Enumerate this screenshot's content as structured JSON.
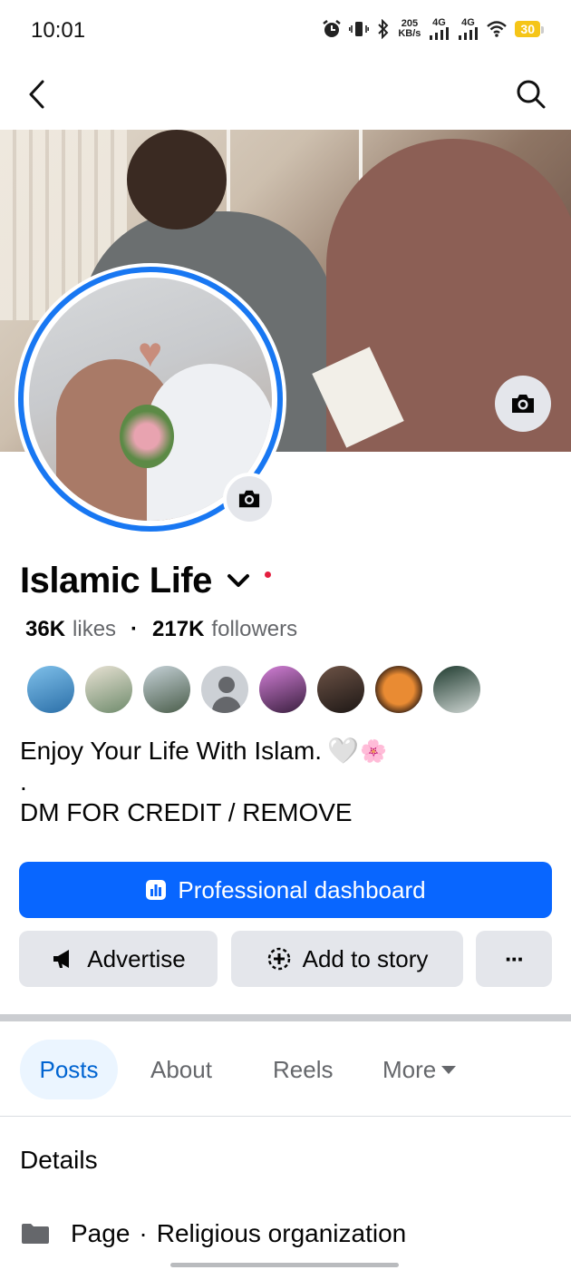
{
  "status_bar": {
    "time": "10:01",
    "speed_value": "205",
    "speed_unit": "KB/s",
    "net1": "4G",
    "net2": "4G",
    "battery": "30"
  },
  "nav": {
    "back_icon": "chevron-left-icon",
    "search_icon": "search-icon"
  },
  "profile": {
    "name": "Islamic Life",
    "likes_count": "36K",
    "likes_label": "likes",
    "separator": "·",
    "followers_count": "217K",
    "followers_label": "followers",
    "follower_avatar_count": 8,
    "bio_line1": "Enjoy Your Life With Islam.",
    "bio_emoji_heart": "🤍",
    "bio_emoji_flower": "🌸",
    "bio_dot": ".",
    "bio_line2": "DM FOR CREDIT / REMOVE"
  },
  "buttons": {
    "dashboard": "Professional dashboard",
    "advertise": "Advertise",
    "add_to_story": "Add to story",
    "more": "···"
  },
  "tabs": [
    {
      "label": "Posts",
      "active": true
    },
    {
      "label": "About",
      "active": false
    },
    {
      "label": "Reels",
      "active": false
    },
    {
      "label": "More",
      "active": false
    }
  ],
  "details": {
    "heading": "Details",
    "page_label": "Page",
    "separator": "·",
    "category": "Religious organization"
  },
  "colors": {
    "primary_blue": "#0866ff",
    "ring_blue": "#1877f2",
    "active_tab_bg": "#ebf5ff",
    "active_tab_text": "#0064d1",
    "notification_dot": "#e41e3f"
  }
}
